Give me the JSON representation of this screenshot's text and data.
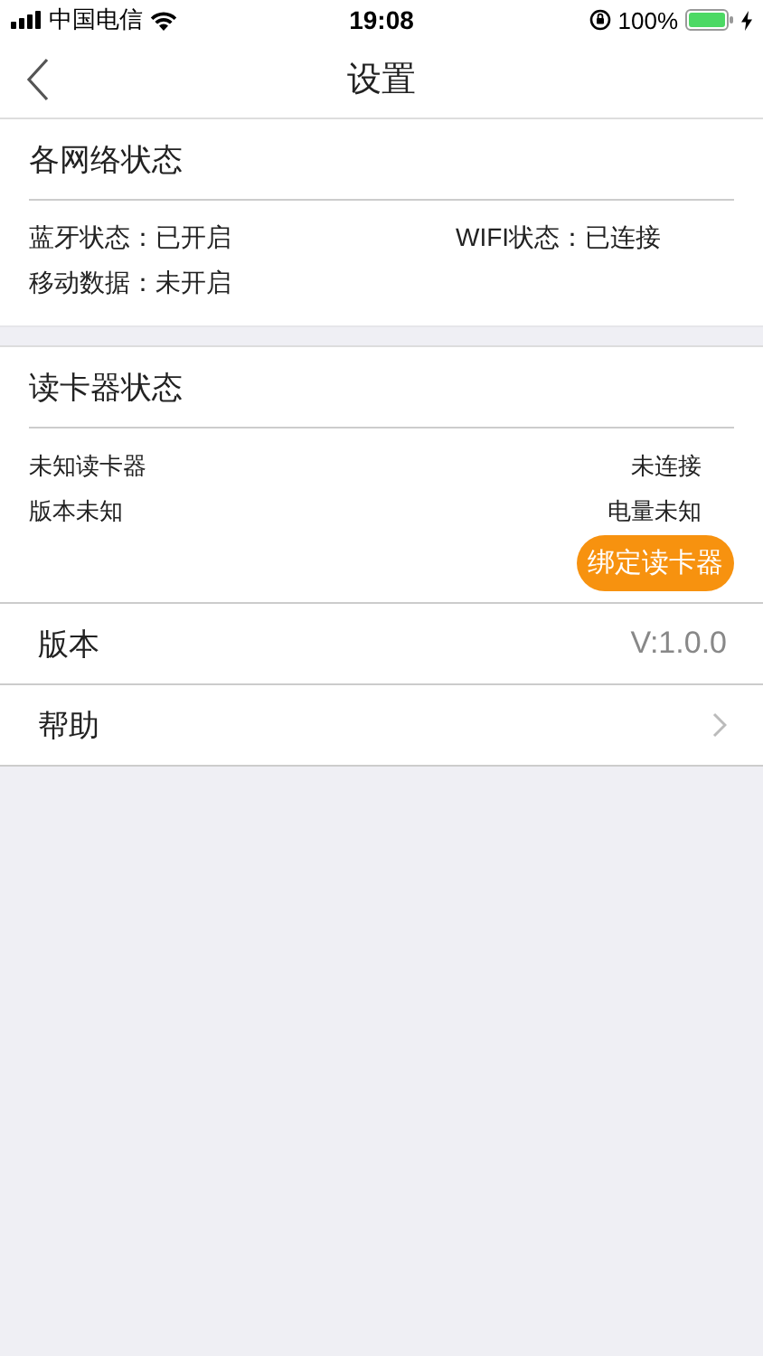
{
  "status_bar": {
    "carrier": "中国电信",
    "time": "19:08",
    "battery": "100%"
  },
  "nav_bar": {
    "title": "设置"
  },
  "network_status": {
    "title": "各网络状态",
    "items": [
      "蓝牙状态：已开启",
      "WIFI状态：已连接",
      "移动数据：未开启"
    ]
  },
  "reader_status": {
    "title": "读卡器状态",
    "name": "未知读卡器",
    "connection": "未连接",
    "version": "版本未知",
    "battery": "电量未知",
    "bind_button": "绑定读卡器"
  },
  "settings": [
    {
      "kind": "value",
      "label": "版本",
      "value": "V:1.0.0"
    },
    {
      "kind": "link",
      "label": "帮助"
    }
  ]
}
